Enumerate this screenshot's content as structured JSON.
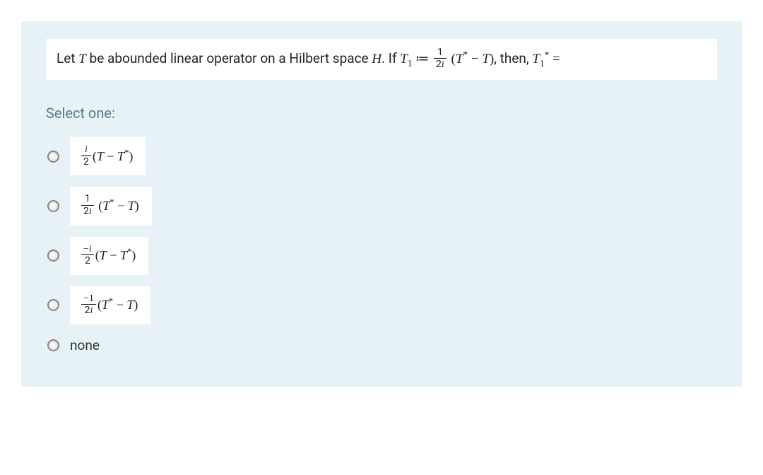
{
  "question": {
    "pre_text": "Let ",
    "var_T": "T",
    "mid1": "  be abounded linear operator on a Hilbert space ",
    "var_H": "H",
    "mid2": ".  If ",
    "T1": "T",
    "T1_sub": "1",
    "assign": " ≔ ",
    "frac_num": "1",
    "frac_den_2": "2",
    "frac_den_i": "i",
    "paren_open": " (",
    "Tstar": "T",
    "star": "*",
    "minus": " − ",
    "T_plain": "T",
    "paren_close": ")",
    "mid3": ", then, ",
    "T1b": "T",
    "T1b_sub": "1",
    "T1b_star": "*",
    "eq": " ="
  },
  "select_label": "Select one:",
  "options": {
    "a": {
      "num": "i",
      "den_2": "2",
      "den_i": "",
      "lparen": "(",
      "A": "T",
      "Astar": "",
      "minus": " − ",
      "B": "T",
      "Bstar": "*",
      "rparen": ")"
    },
    "b": {
      "num": "1",
      "den_2": "2",
      "den_i": "i",
      "lparen": " (",
      "A": "T",
      "Astar": "*",
      "minus": " − ",
      "B": "T",
      "Bstar": "",
      "rparen": ")"
    },
    "c": {
      "num": "−i",
      "den_2": "2",
      "den_i": "",
      "lparen": "(",
      "A": "T",
      "Astar": "",
      "minus": " − ",
      "B": "T",
      "Bstar": "*",
      "rparen": ")"
    },
    "d": {
      "num": "−1",
      "den_2": "2",
      "den_i": "i",
      "lparen": "(",
      "A": "T",
      "Astar": "*",
      "minus": " − ",
      "B": "T",
      "Bstar": "",
      "rparen": ")"
    },
    "e": {
      "label": "none"
    }
  }
}
